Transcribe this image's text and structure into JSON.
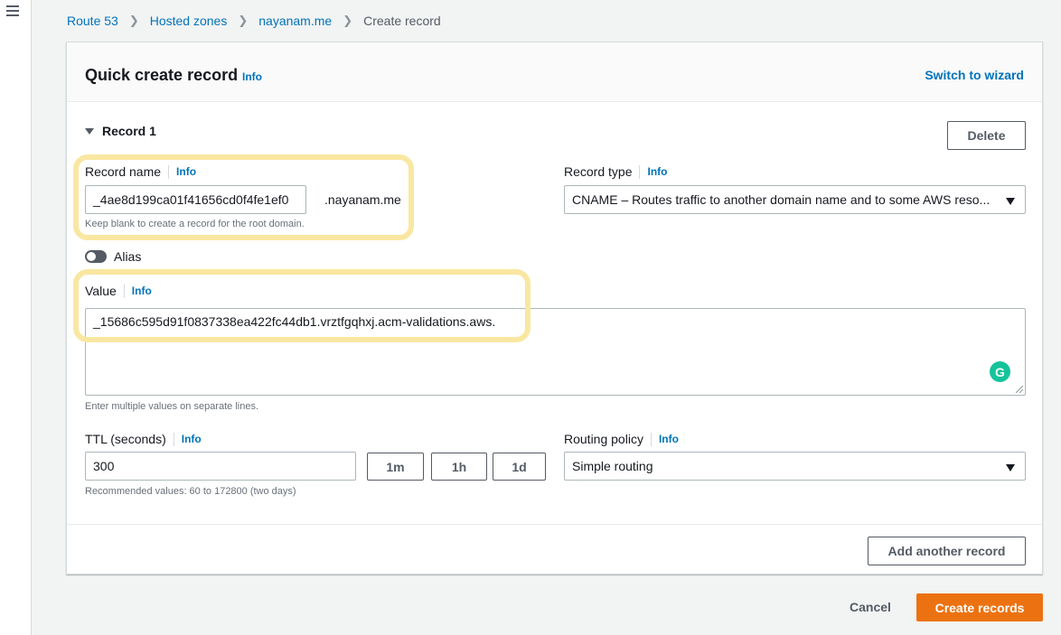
{
  "breadcrumb": {
    "items": [
      "Route 53",
      "Hosted zones",
      "nayanam.me"
    ],
    "current": "Create record"
  },
  "panel": {
    "title": "Quick create record",
    "info": "Info",
    "switch_wizard": "Switch to wizard"
  },
  "record": {
    "toggle_label": "Record 1",
    "delete_label": "Delete",
    "record_name": {
      "label": "Record name",
      "info": "Info",
      "value": "_4ae8d199ca01f41656cd0f4fe1ef0",
      "suffix": ".nayanam.me",
      "hint": "Keep blank to create a record for the root domain."
    },
    "record_type": {
      "label": "Record type",
      "info": "Info",
      "value": "CNAME – Routes traffic to another domain name and to some AWS reso..."
    },
    "alias": {
      "label": "Alias",
      "enabled": false
    },
    "value_field": {
      "label": "Value",
      "info": "Info",
      "value": "_15686c595d91f0837338ea422fc44db1.vrztfgqhxj.acm-validations.aws.",
      "hint": "Enter multiple values on separate lines."
    },
    "ttl": {
      "label": "TTL (seconds)",
      "info": "Info",
      "value": "300",
      "presets": [
        "1m",
        "1h",
        "1d"
      ],
      "hint": "Recommended values: 60 to 172800 (two days)"
    },
    "routing_policy": {
      "label": "Routing policy",
      "info": "Info",
      "value": "Simple routing"
    }
  },
  "add_another_label": "Add another record",
  "footer": {
    "cancel_label": "Cancel",
    "create_label": "Create records"
  },
  "colors": {
    "link": "#0073bb",
    "primary": "#ec7211",
    "highlight": "#f9e7a1",
    "grammarly": "#15c39a"
  }
}
